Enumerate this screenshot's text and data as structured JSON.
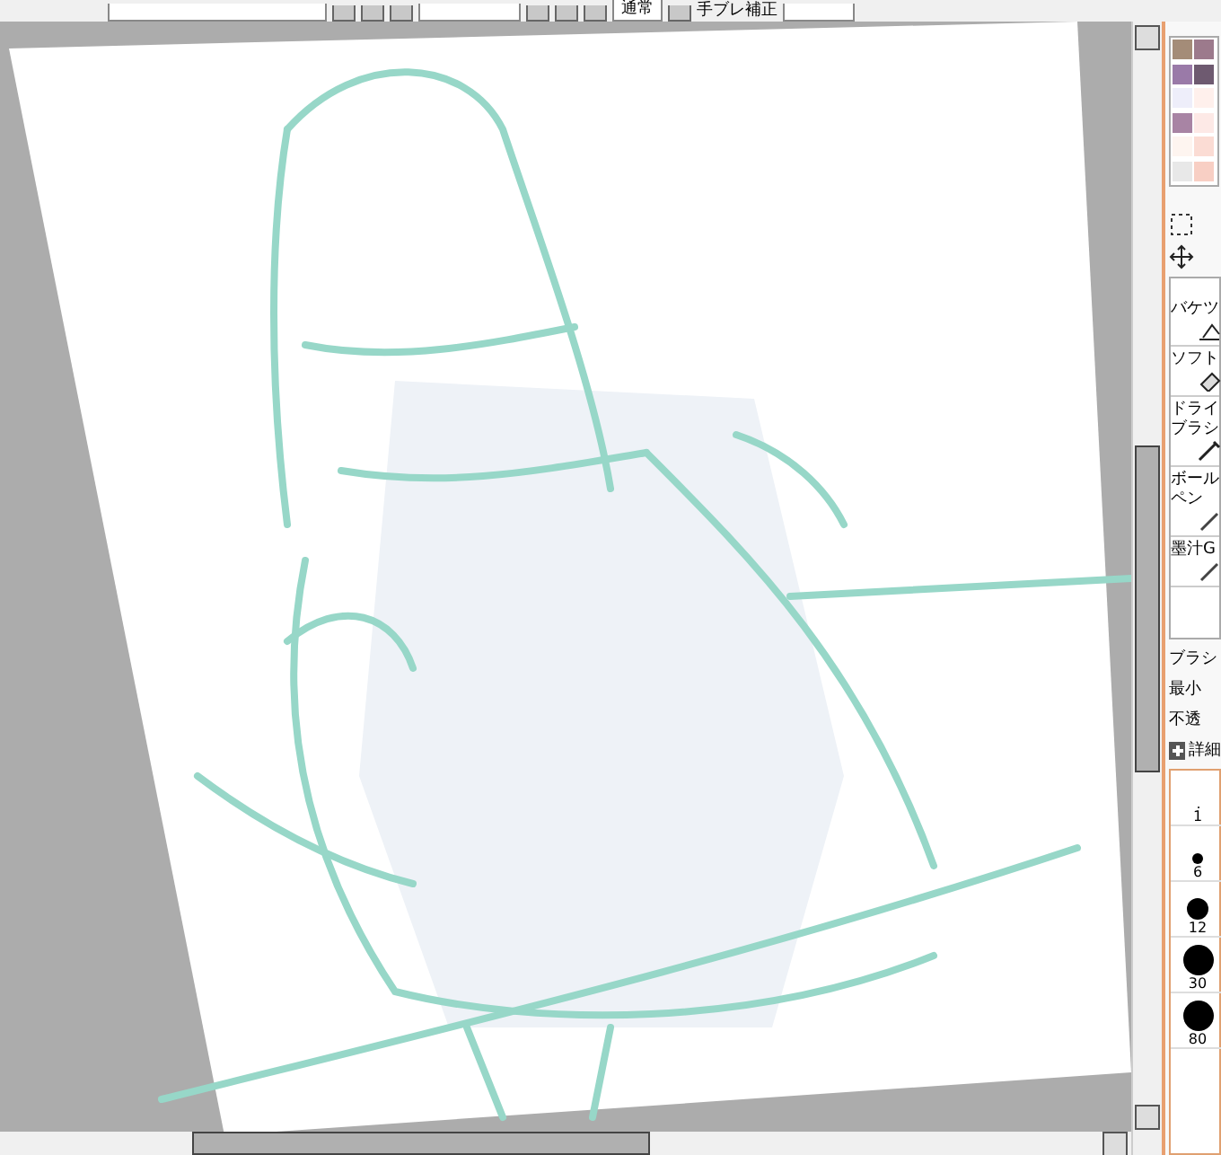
{
  "toolbar": {
    "blend_mode": "通常",
    "stabilizer_label": "手ブレ補正"
  },
  "palette": [
    {
      "color": "#a48c78"
    },
    {
      "color": "#9c7a8c"
    },
    {
      "color": "#9a7aa8"
    },
    {
      "color": "#6e5a70"
    },
    {
      "color": "#eeeefa"
    },
    {
      "color": "#fff0ec"
    },
    {
      "color": "#a884a4"
    },
    {
      "color": "#fde9e6"
    },
    {
      "color": "#fef5f0"
    },
    {
      "color": "#fbdcd4"
    },
    {
      "color": "#e8e8e8"
    },
    {
      "color": "#f8cfc4"
    }
  ],
  "tools": [
    {
      "label": "バケツ",
      "kind": "bucket"
    },
    {
      "label": "ソフト",
      "kind": "eraser"
    },
    {
      "label": "ドライブラシ",
      "kind": "brush"
    },
    {
      "label": "ボールペン",
      "kind": "pen"
    },
    {
      "label": "墨汁G",
      "kind": "pen"
    }
  ],
  "brush_settings": [
    {
      "label": "ブラシ"
    },
    {
      "label": "最小"
    },
    {
      "label": "不透"
    }
  ],
  "details_label": "詳細",
  "brush_sizes": [
    "1",
    "6",
    "12",
    "30",
    "80"
  ]
}
